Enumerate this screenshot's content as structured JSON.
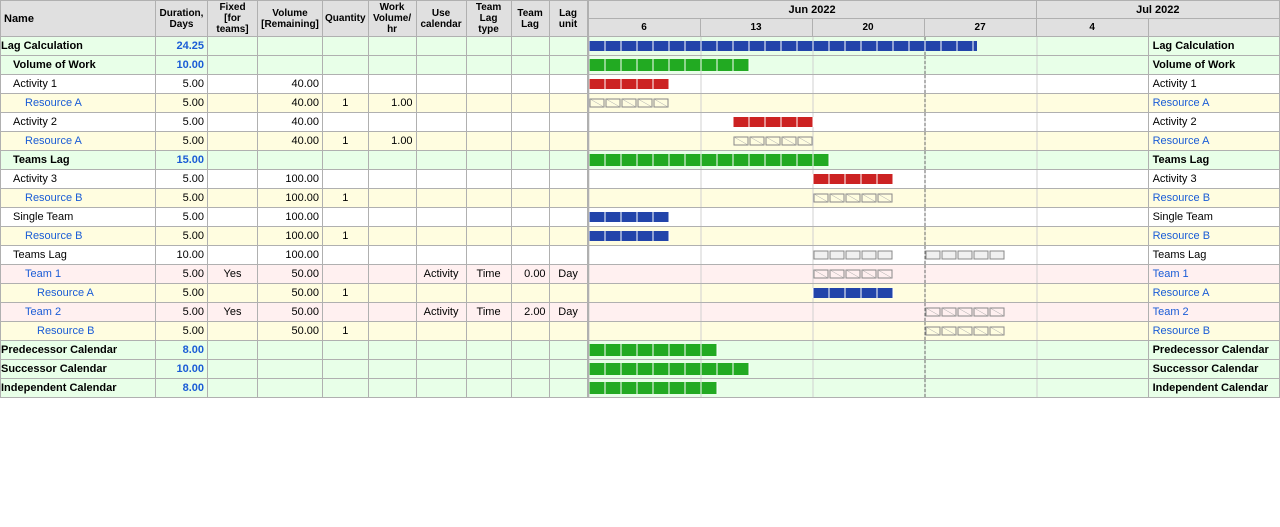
{
  "headers": {
    "name": "Name",
    "duration": "Duration, Days",
    "fixed": "Fixed [for teams]",
    "volume": "Volume [Remaining]",
    "quantity": "Quantity",
    "workVolume": "Work Volume/ hr",
    "useCalendar": "Use calendar",
    "teamLagType": "Team Lag type",
    "teamLag": "Team Lag",
    "lagUnit": "Lag unit"
  },
  "ganttMonths": [
    "Jun 2022",
    "Jul 2022"
  ],
  "ganttDates": [
    "6",
    "13",
    "20",
    "27",
    "4"
  ],
  "rows": [
    {
      "name": "Lag Calculation",
      "dur": "24.25",
      "fixed": "",
      "vol": "",
      "qty": "",
      "work": "",
      "use": "",
      "lagtype": "",
      "teamlag": "",
      "lagunit": "",
      "indent": 0,
      "type": "summary-top",
      "bg": "bg-green"
    },
    {
      "name": "Volume of Work",
      "dur": "10.00",
      "fixed": "",
      "vol": "",
      "qty": "",
      "work": "",
      "use": "",
      "lagtype": "",
      "teamlag": "",
      "lagunit": "",
      "indent": 1,
      "type": "summary",
      "bg": "bg-green"
    },
    {
      "name": "Activity 1",
      "dur": "5.00",
      "fixed": "",
      "vol": "40.00",
      "qty": "",
      "work": "",
      "use": "",
      "lagtype": "",
      "teamlag": "",
      "lagunit": "",
      "indent": 1,
      "type": "activity",
      "bg": "bg-white"
    },
    {
      "name": "Resource A",
      "dur": "5.00",
      "fixed": "",
      "vol": "40.00",
      "qty": "1",
      "work": "1.00",
      "use": "",
      "lagtype": "",
      "teamlag": "",
      "lagunit": "",
      "indent": 2,
      "type": "resource",
      "bg": "bg-yellow"
    },
    {
      "name": "Activity 2",
      "dur": "5.00",
      "fixed": "",
      "vol": "40.00",
      "qty": "",
      "work": "",
      "use": "",
      "lagtype": "",
      "teamlag": "",
      "lagunit": "",
      "indent": 1,
      "type": "activity",
      "bg": "bg-white"
    },
    {
      "name": "Resource A",
      "dur": "5.00",
      "fixed": "",
      "vol": "40.00",
      "qty": "1",
      "work": "1.00",
      "use": "",
      "lagtype": "",
      "teamlag": "",
      "lagunit": "",
      "indent": 2,
      "type": "resource",
      "bg": "bg-yellow"
    },
    {
      "name": "Teams Lag",
      "dur": "15.00",
      "fixed": "",
      "vol": "",
      "qty": "",
      "work": "",
      "use": "",
      "lagtype": "",
      "teamlag": "",
      "lagunit": "",
      "indent": 1,
      "type": "summary",
      "bg": "bg-green"
    },
    {
      "name": "Activity 3",
      "dur": "5.00",
      "fixed": "",
      "vol": "100.00",
      "qty": "",
      "work": "",
      "use": "",
      "lagtype": "",
      "teamlag": "",
      "lagunit": "",
      "indent": 1,
      "type": "activity",
      "bg": "bg-white"
    },
    {
      "name": "Resource B",
      "dur": "5.00",
      "fixed": "",
      "vol": "100.00",
      "qty": "1",
      "work": "",
      "use": "",
      "lagtype": "",
      "teamlag": "",
      "lagunit": "",
      "indent": 2,
      "type": "resource",
      "bg": "bg-yellow"
    },
    {
      "name": "Single Team",
      "dur": "5.00",
      "fixed": "",
      "vol": "100.00",
      "qty": "",
      "work": "",
      "use": "",
      "lagtype": "",
      "teamlag": "",
      "lagunit": "",
      "indent": 1,
      "type": "activity",
      "bg": "bg-white"
    },
    {
      "name": "Resource B",
      "dur": "5.00",
      "fixed": "",
      "vol": "100.00",
      "qty": "1",
      "work": "",
      "use": "",
      "lagtype": "",
      "teamlag": "",
      "lagunit": "",
      "indent": 2,
      "type": "resource",
      "bg": "bg-yellow"
    },
    {
      "name": "Teams Lag",
      "dur": "10.00",
      "fixed": "",
      "vol": "100.00",
      "qty": "",
      "work": "",
      "use": "",
      "lagtype": "",
      "teamlag": "",
      "lagunit": "",
      "indent": 1,
      "type": "activity",
      "bg": "bg-white"
    },
    {
      "name": "Team 1",
      "dur": "5.00",
      "fixed": "Yes",
      "vol": "50.00",
      "qty": "",
      "work": "",
      "use": "Activity",
      "lagtype": "Time",
      "teamlag": "0.00",
      "lagunit": "Day",
      "indent": 2,
      "type": "team",
      "bg": "bg-pink"
    },
    {
      "name": "Resource A",
      "dur": "5.00",
      "fixed": "",
      "vol": "50.00",
      "qty": "1",
      "work": "",
      "use": "",
      "lagtype": "",
      "teamlag": "",
      "lagunit": "",
      "indent": 3,
      "type": "resource",
      "bg": "bg-yellow"
    },
    {
      "name": "Team 2",
      "dur": "5.00",
      "fixed": "Yes",
      "vol": "50.00",
      "qty": "",
      "work": "",
      "use": "Activity",
      "lagtype": "Time",
      "teamlag": "2.00",
      "lagunit": "Day",
      "indent": 2,
      "type": "team",
      "bg": "bg-pink"
    },
    {
      "name": "Resource B",
      "dur": "5.00",
      "fixed": "",
      "vol": "50.00",
      "qty": "1",
      "work": "",
      "use": "",
      "lagtype": "",
      "teamlag": "",
      "lagunit": "",
      "indent": 3,
      "type": "resource",
      "bg": "bg-yellow"
    },
    {
      "name": "Predecessor Calendar",
      "dur": "8.00",
      "fixed": "",
      "vol": "",
      "qty": "",
      "work": "",
      "use": "",
      "lagtype": "",
      "teamlag": "",
      "lagunit": "",
      "indent": 0,
      "type": "summary-top",
      "bg": "bg-green"
    },
    {
      "name": "Successor Calendar",
      "dur": "10.00",
      "fixed": "",
      "vol": "",
      "qty": "",
      "work": "",
      "use": "",
      "lagtype": "",
      "teamlag": "",
      "lagunit": "",
      "indent": 0,
      "type": "summary-top",
      "bg": "bg-green"
    },
    {
      "name": "Independent Calendar",
      "dur": "8.00",
      "fixed": "",
      "vol": "",
      "qty": "",
      "work": "",
      "use": "",
      "lagtype": "",
      "teamlag": "",
      "lagunit": "",
      "indent": 0,
      "type": "summary-top",
      "bg": "bg-green"
    }
  ],
  "ganttLabels": {
    "lagCalculation": "Lag Calculation",
    "volumeOfWork": "Volume of Work",
    "activity1": "Activity 1",
    "resourceA1": "Resource A",
    "activity2": "Activity 2",
    "resourceA2": "Resource A",
    "teamsLag": "Teams Lag",
    "activity3": "Activity 3",
    "resourceB1": "Resource B",
    "singleTeam": "Single Team",
    "resourceB2": "Resource B",
    "teamsLag2": "Teams Lag",
    "team1": "Team 1",
    "resourceA3": "Resource A",
    "team2": "Team 2",
    "resourceB3": "Resource B",
    "predecessorCalendar": "Predecessor Calendar",
    "successorCalendar": "Successor Calendar",
    "independentCalendar": "Independent Calendar"
  }
}
